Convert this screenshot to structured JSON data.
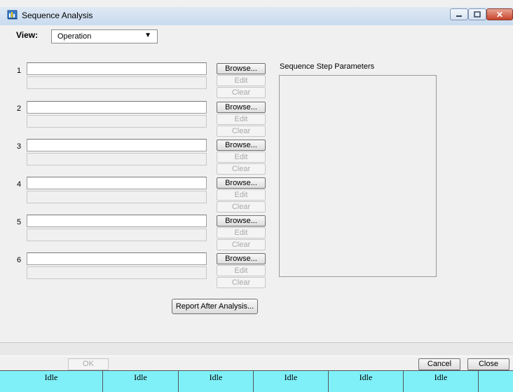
{
  "window": {
    "title": "Sequence Analysis",
    "min_icon": "minimize-icon",
    "max_icon": "maximize-icon",
    "close_glyph": "✕"
  },
  "view": {
    "label": "View:",
    "selected": "Operation",
    "caret": "▼"
  },
  "rows": [
    {
      "num": "1",
      "browse": "Browse...",
      "edit": "Edit",
      "clear": "Clear"
    },
    {
      "num": "2",
      "browse": "Browse...",
      "edit": "Edit",
      "clear": "Clear"
    },
    {
      "num": "3",
      "browse": "Browse...",
      "edit": "Edit",
      "clear": "Clear"
    },
    {
      "num": "4",
      "browse": "Browse...",
      "edit": "Edit",
      "clear": "Clear"
    },
    {
      "num": "5",
      "browse": "Browse...",
      "edit": "Edit",
      "clear": "Clear"
    },
    {
      "num": "6",
      "browse": "Browse...",
      "edit": "Edit",
      "clear": "Clear"
    }
  ],
  "params": {
    "label": "Sequence Step Parameters"
  },
  "report_button": "Report After Analysis...",
  "footer": {
    "ok": "OK",
    "cancel": "Cancel",
    "close": "Close"
  },
  "status": [
    "Idle",
    "Idle",
    "Idle",
    "Idle",
    "Idle",
    "Idle",
    ""
  ]
}
